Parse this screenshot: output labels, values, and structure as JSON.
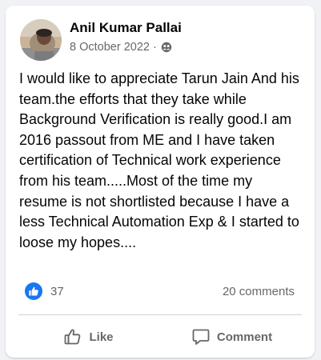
{
  "post": {
    "author": "Anil Kumar Pallai",
    "date": "8 October 2022",
    "separator": "·",
    "audience_icon": "friends-icon",
    "text": "I would like to appreciate Tarun Jain And his team.the efforts that they take while Background Verification is really good.I am 2016 passout from ME and I have taken certification of Technical work experience from his team.....Most of the time my resume is not shortlisted because I have a less Technical Automation Exp & I started to loose my hopes...."
  },
  "stats": {
    "reaction_icon": "like-reaction-icon",
    "reaction_count": "37",
    "comments": "20 comments"
  },
  "actions": {
    "like_label": "Like",
    "like_icon": "thumbs-up-icon",
    "comment_label": "Comment",
    "comment_icon": "speech-bubble-icon"
  },
  "colors": {
    "page_background": "#f0f2f5",
    "card": "#ffffff",
    "primary_text": "#050505",
    "secondary_text": "#65676b",
    "reaction_blue": "#1877f2",
    "divider": "#ced0d4"
  }
}
